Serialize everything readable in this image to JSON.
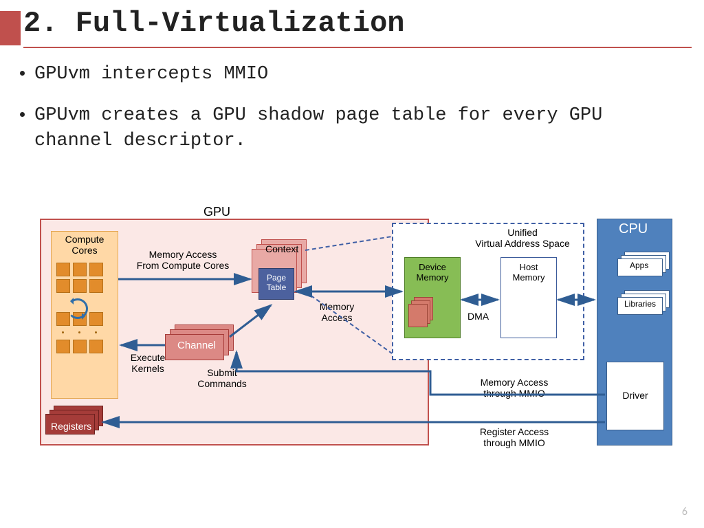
{
  "slide": {
    "title": "2. Full-Virtualization",
    "bullets": [
      "GPUvm intercepts MMIO",
      "GPUvm creates a GPU shadow page table for every GPU channel descriptor."
    ],
    "page_number": "6"
  },
  "diagram": {
    "gpu": {
      "label": "GPU",
      "compute_cores": "Compute\nCores",
      "context": "Context",
      "page_table": "Page\nTable",
      "channel": "Channel",
      "registers": "Registers",
      "mem_access_cores": "Memory Access\nFrom Compute Cores",
      "execute_kernels": "Execute\nKernels",
      "submit_commands": "Submit\nCommands",
      "memory_access": "Memory\nAccess"
    },
    "uas": {
      "title": "Unified\nVirtual Address Space",
      "device_memory": "Device\nMemory",
      "host_memory": "Host\nMemory",
      "dma": "DMA"
    },
    "cpu": {
      "label": "CPU",
      "apps": "Apps",
      "libraries": "Libraries",
      "driver": "Driver",
      "mem_mmio": "Memory Access\nthrough MMIO",
      "reg_mmio": "Register Access\nthrough MMIO"
    }
  }
}
